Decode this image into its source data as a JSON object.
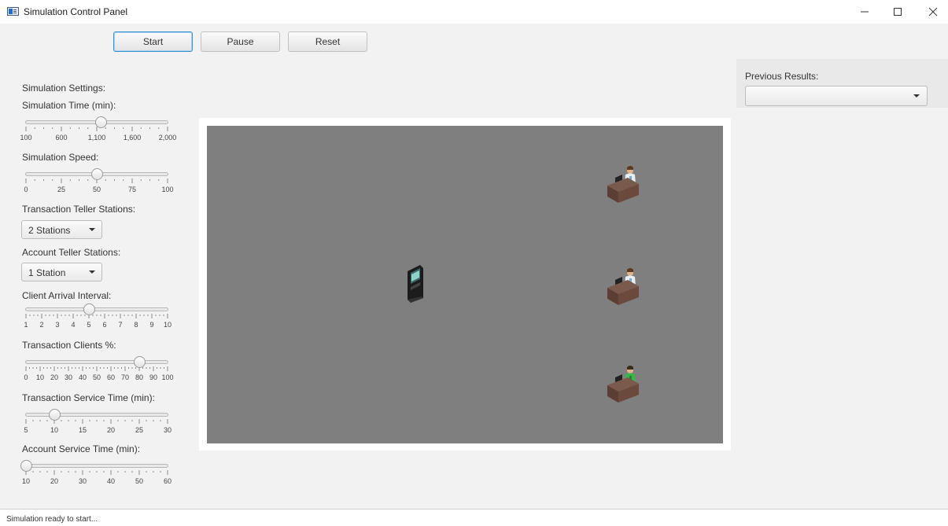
{
  "window": {
    "title": "Simulation Control Panel",
    "icons": [
      "app-icon",
      "minimize-icon",
      "maximize-icon",
      "close-icon"
    ]
  },
  "toolbar": {
    "start_label": "Start",
    "pause_label": "Pause",
    "reset_label": "Reset"
  },
  "settings": {
    "heading": "Simulation Settings:",
    "simulation_time": {
      "label": "Simulation Time (min):",
      "min": 100,
      "max": 2000,
      "value": 1100,
      "tick_labels": [
        "100",
        "600",
        "1,100",
        "1,600",
        "2,000"
      ]
    },
    "simulation_speed": {
      "label": "Simulation Speed:",
      "min": 0,
      "max": 100,
      "value": 50,
      "tick_labels": [
        "0",
        "25",
        "50",
        "75",
        "100"
      ]
    },
    "transaction_teller": {
      "label": "Transaction Teller Stations:",
      "selected": "2 Stations"
    },
    "account_teller": {
      "label": "Account Teller Stations:",
      "selected": "1 Station"
    },
    "client_arrival": {
      "label": "Client Arrival Interval:",
      "min": 1,
      "max": 10,
      "value": 5,
      "tick_labels": [
        "1",
        "2",
        "3",
        "4",
        "5",
        "6",
        "7",
        "8",
        "9",
        "10"
      ]
    },
    "transaction_clients": {
      "label": "Transaction Clients %:",
      "min": 0,
      "max": 100,
      "value": 80,
      "tick_labels": [
        "0",
        "10",
        "20",
        "30",
        "40",
        "50",
        "60",
        "70",
        "80",
        "90",
        "100"
      ]
    },
    "transaction_service_time": {
      "label": "Transaction Service Time (min):",
      "min": 5,
      "max": 30,
      "value": 10,
      "tick_labels": [
        "5",
        "10",
        "15",
        "20",
        "25",
        "30"
      ]
    },
    "account_service_time": {
      "label": "Account Service Time (min):",
      "min": 10,
      "max": 60,
      "value": 10,
      "tick_labels": [
        "10",
        "20",
        "30",
        "40",
        "50",
        "60"
      ]
    }
  },
  "simulation_view": {
    "background_color": "#7f7f7f",
    "sprites": [
      "atm-kiosk-icon",
      "teller-desk-icon",
      "teller-desk-icon",
      "teller-desk-icon"
    ]
  },
  "previous_results": {
    "label": "Previous Results:",
    "selected": ""
  },
  "status": {
    "text": "Simulation ready to start..."
  },
  "colors": {
    "focus_accent": "#3a91d0",
    "panel_background": "#f2f2f2"
  }
}
